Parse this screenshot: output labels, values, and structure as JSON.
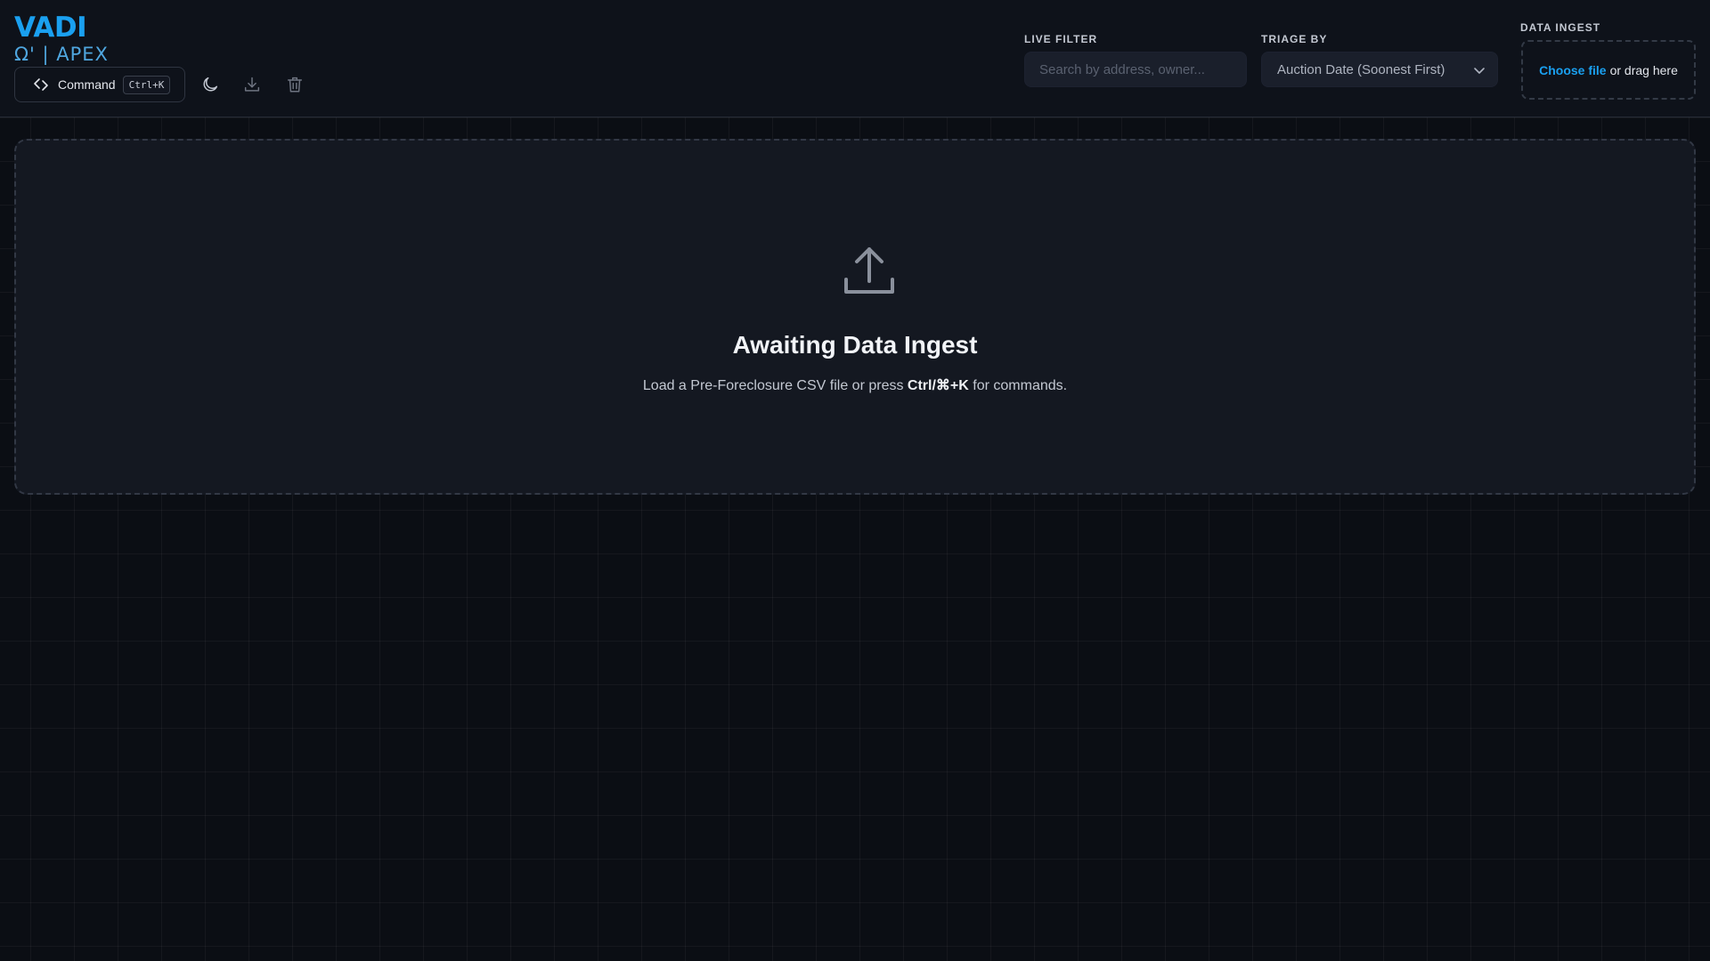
{
  "brand": {
    "title": "VADI",
    "subtitle": "Ω' | APEX"
  },
  "toolbar": {
    "command_label": "Command",
    "command_shortcut": "Ctrl+K",
    "icons": [
      "code-icon",
      "moon-icon",
      "download-icon",
      "trash-icon"
    ]
  },
  "filters": {
    "live_filter_label": "LIVE FILTER",
    "search_placeholder": "Search by address, owner...",
    "triage_label": "TRIAGE BY",
    "triage_value": "Auction Date (Soonest First)"
  },
  "ingest": {
    "label": "DATA INGEST",
    "choose_file": "Choose file",
    "drag_text": "or drag here"
  },
  "empty_state": {
    "title": "Awaiting Data Ingest",
    "desc_before": "Load a Pre-Foreclosure CSV file or press",
    "desc_shortcut": "Ctrl/⌘+K",
    "desc_after": "for commands."
  },
  "colors": {
    "accent": "#1aa0f0",
    "background": "#0b0e14",
    "header": "#0e121a",
    "panel": "#141821"
  }
}
